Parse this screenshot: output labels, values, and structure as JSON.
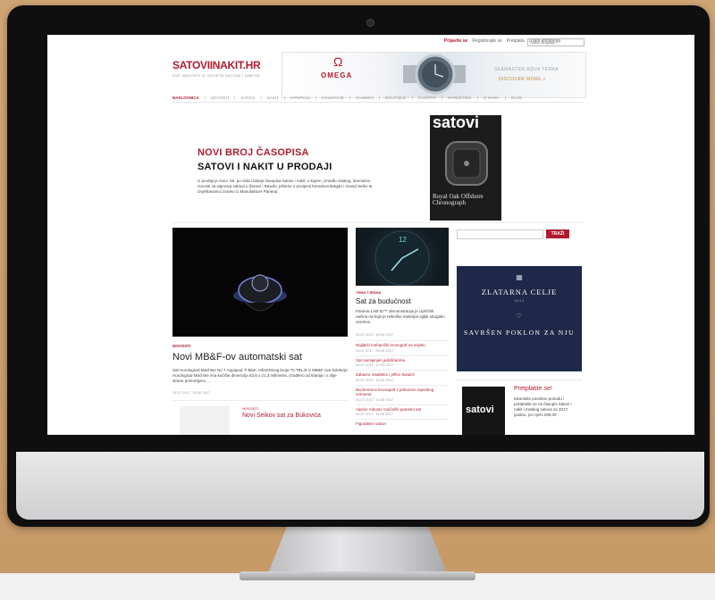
{
  "site": {
    "logo": "SATOVIINAKIT.HR",
    "tagline": "SVE NOVOSTI IZ SVIJETA SATOVA I NAKITA"
  },
  "topbar": {
    "links": [
      "Prijavite se",
      "Registrirajte se",
      "Pretplata",
      "Uvjeti korištenja"
    ],
    "language_select": "Select language"
  },
  "banner": {
    "brand": "OMEGA",
    "brand_symbol": "Ω",
    "line1": "SEAMASTER AQUA TERRA",
    "line2": "DISCOVER MORE >"
  },
  "nav": {
    "items": [
      "NASLOVNICA",
      "NOVOSTI",
      "SATOVI",
      "NAKIT",
      "INTERVJU",
      "KOLEKCIJE",
      "SAJMOVI",
      "BOUTIQUE",
      "ČASOPIS",
      "MARKETING",
      "O NAMA",
      "BLOG"
    ]
  },
  "promo": {
    "heading1": "NOVI BROJ ČASOPISA",
    "heading2": "SATOVI I NAKIT U PRODAJI",
    "text": "U prodaji je novo, 56. po redu izdanje časopisa Satovi i nakit, u kojem, između ostalog, donosimo novosti sa sajmova satova u Ženevi i Baselu, pišemo o povijesti brendova Bvlgari i Grand Seiko te izvještavamo izravno iz Manufakture Panerai.",
    "magazine_title": "satovi",
    "magazine_cover_text": "Royal Oak Offshore Chronograph"
  },
  "feature": {
    "category": "NOVOSTI",
    "title": "Novi MB&F-ov automatski sat",
    "text": "Sat Horological Machine No 7 Aquapod Ti Blue, referentnog broja 70.TBL.B iz MB&F-ove kolekcije Horological Machine ima kućište dimenzija 53,8 x 21,3 milimetra, izrađeno od titanija i s obje strane prelomljeno ...",
    "date": "25.07.2017. 10:30 2017"
  },
  "secondary": {
    "category": "TEMA TJEDNA",
    "title": "Sat za budućnost",
    "text": "Panerai LAB-ID™ demonstracija je različitih načina na koje je nekoliko materijal ugljik obogatio urarstvo.",
    "date": "24.07.2017. 10:04 2017"
  },
  "news_list": [
    {
      "title": "Najlakši mehanički kronograf na svijetu",
      "date": "24.07.2017. 09:45 2017"
    },
    {
      "title": "Sat namijenjen jedriličarima",
      "date": "24.07.2017. 10:29 2017"
    },
    {
      "title": "Zabavni, kvalitetni i jeftini Swatch",
      "date": "24.07.2017. 10:29 2017"
    },
    {
      "title": "Bucherenov kronograf s prikazom svjetskog vremena",
      "date": "24.07.2017. 10:28 2017"
    },
    {
      "title": "Alpinin robusni roničački pametni sat",
      "date": "24.07.2017. 11:28 2017"
    },
    {
      "title": "Figurativni satovi",
      "date": ""
    }
  ],
  "small_article": {
    "category": "NOVOSTI",
    "title": "Novi Seikov sat za Bukovića"
  },
  "sidebar": {
    "search_button": "TRAŽI",
    "ad_title": "ZLATARNA CELJE",
    "ad_sub": "1844",
    "ad_tagline": "SAVRŠEN POKLON ZA NJU",
    "subscribe_title": "Pretplatite se!",
    "subscribe_text": "Iskoristite posebnu ponudu i pretplatite se na časopis Satovi i nakit i Katalog satova za 2017. godinu, po cijeni 299,00",
    "subscribe_mag": "satovi"
  },
  "colors": {
    "brand_red": "#b01c2e",
    "ad_navy": "#1f2848",
    "wall": "#c99d6a"
  }
}
